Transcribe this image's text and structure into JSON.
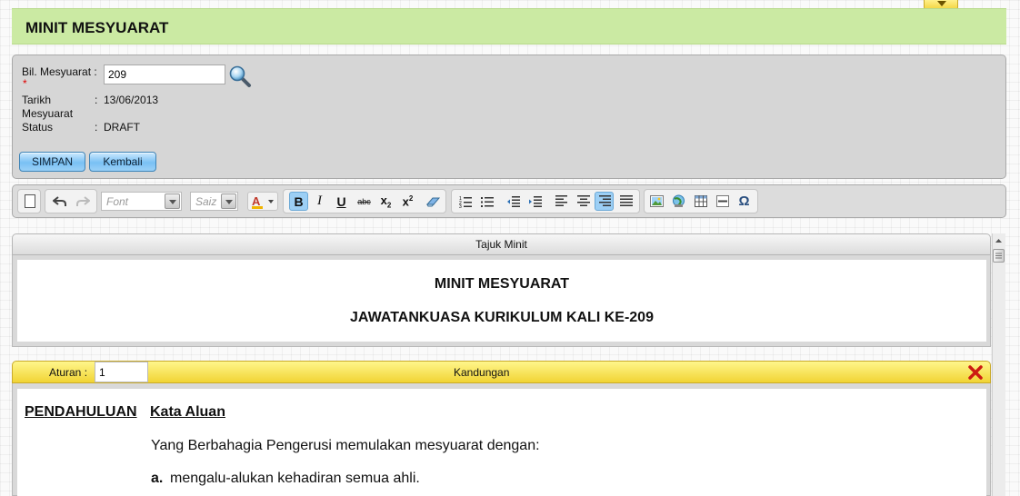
{
  "header": {
    "title": "MINIT MESYUARAT"
  },
  "form": {
    "bil_label": "Bil. Mesyuarat :",
    "required_mark": "*",
    "bil_value": "209",
    "tarikh_label_1": "Tarikh",
    "tarikh_label_2": "Mesyuarat",
    "tarikh_colon": ":",
    "tarikh_value": "13/06/2013",
    "status_label": "Status",
    "status_colon": ":",
    "status_value": "DRAFT"
  },
  "actions": {
    "save_label": "SIMPAN",
    "back_label": "Kembali"
  },
  "toolbar": {
    "font_placeholder": "Font",
    "size_placeholder": "Saiz",
    "bold": "B",
    "italic": "I",
    "underline": "U",
    "strike": "abc",
    "subscript": "x",
    "superscript": "x",
    "special_char": "Ω"
  },
  "tajuk": {
    "header_label": "Tajuk Minit",
    "line1": "MINIT MESYUARAT",
    "line2": "JAWATANKUASA KURIKULUM KALI KE-209"
  },
  "kandungan": {
    "aturan_label": "Aturan :",
    "aturan_value": "1",
    "header_label": "Kandungan",
    "section_title": "PENDAHULUAN",
    "subsection_title": "Kata Aluan",
    "paragraph": "Yang Berbahagia Pengerusi memulakan mesyuarat dengan:",
    "item_marker": "a.",
    "item_text": "mengalu-alukan kehadiran semua ahli."
  },
  "colors": {
    "header_bg": "#cbeaa3",
    "button_blue": "#79c0f4",
    "kandungan_bar": "#f1d434",
    "delete_red": "#cc1b12"
  }
}
